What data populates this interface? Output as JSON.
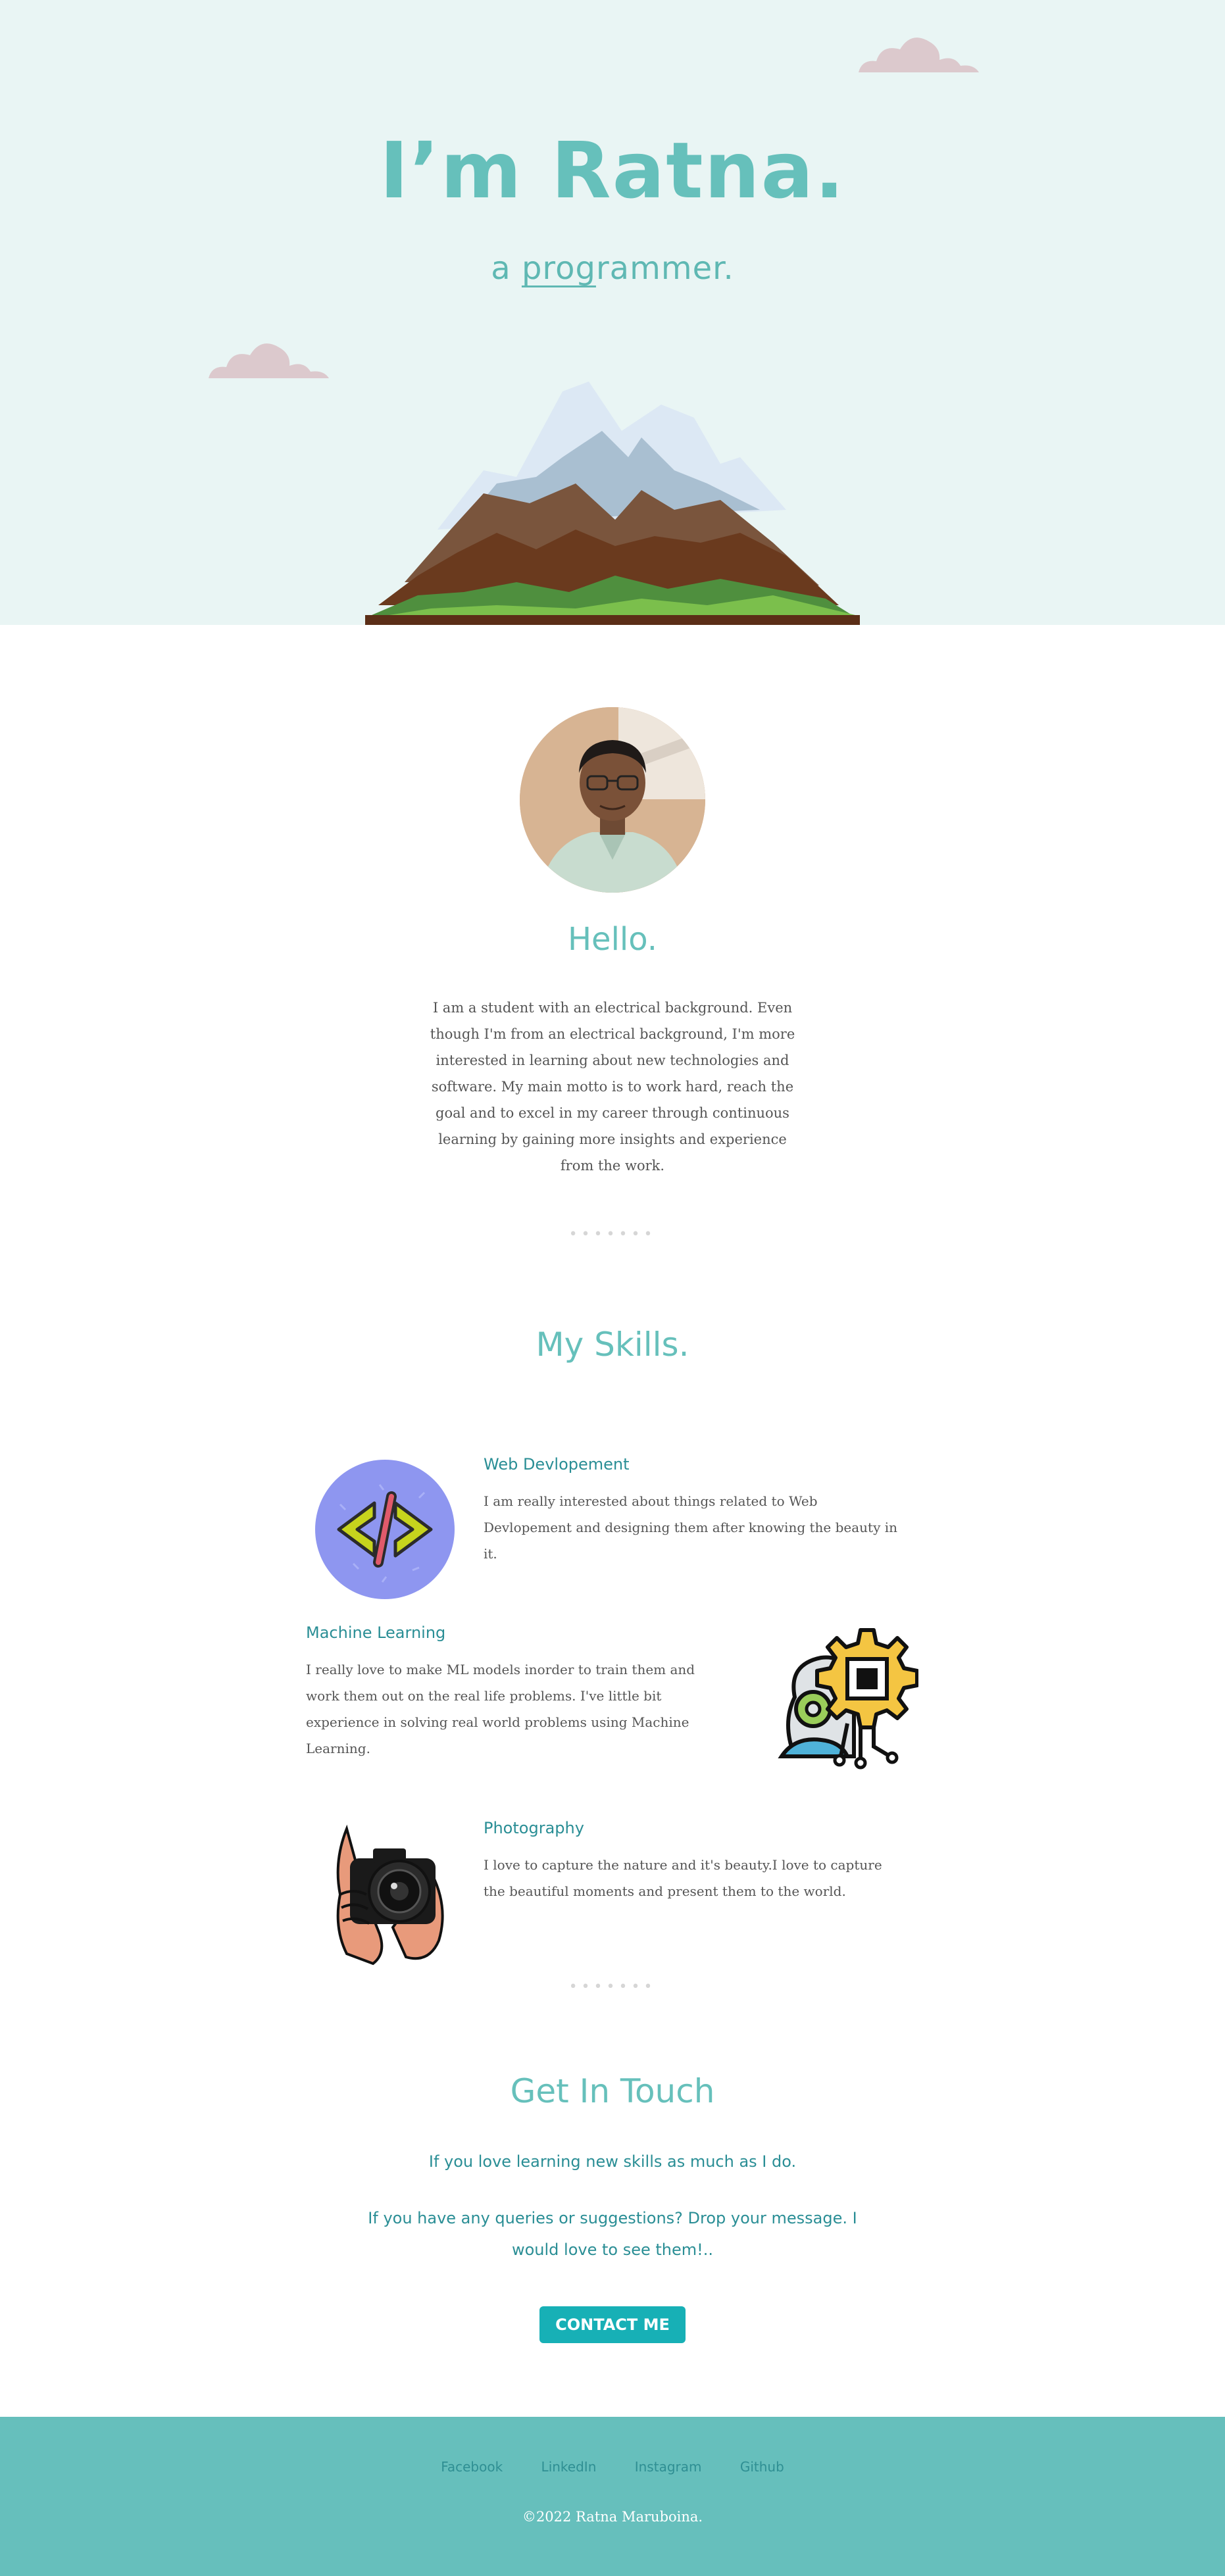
{
  "colors": {
    "accent": "#66c0bb",
    "hero_background": "#e9f5f4",
    "skill_heading": "#2a8e95",
    "button": "#17b0b6",
    "footer_background": "#66bfbc"
  },
  "hero": {
    "title": "I’m Ratna.",
    "subtitle_prefix": "a ",
    "subtitle_underlined": "prog",
    "subtitle_rest": "rammer.",
    "decorations": [
      "cloud-icon",
      "cloud-icon",
      "mountain-icon"
    ]
  },
  "about": {
    "photo": "profile-photo",
    "heading": "Hello.",
    "body": "I am a student with an electrical background. Even though I'm from an electrical background, I'm more interested in learning about new technologies and software. My main motto is to work hard, reach the goal and to excel in my career through continuous learning by gaining more insights and experience from the work."
  },
  "separator": "•••••••",
  "skills": {
    "heading": "My Skills.",
    "items": [
      {
        "title": "Web Devlopement",
        "icon": "code-icon",
        "text": "I am really interested about things related to Web Devlopement and designing them after knowing the beauty in it."
      },
      {
        "title": "Machine Learning",
        "icon": "robot-chip-icon",
        "text": "I really love to make ML models inorder to train them and work them out on the real life problems. I've little bit experience in solving real world problems using Machine Learning."
      },
      {
        "title": "Photography",
        "icon": "camera-icon",
        "text": "I love to capture the nature and it's beauty.I love to capture the beautiful moments and present them to the world."
      }
    ]
  },
  "contact": {
    "heading": "Get In Touch",
    "line1": "If you love learning new skills as much as I do.",
    "line2": "If you have any queries or suggestions? Drop your message. I would love to see them!..",
    "button_label": "CONTACT ME"
  },
  "footer": {
    "links": [
      "Facebook",
      "LinkedIn",
      "Instagram",
      "Github"
    ],
    "copyright": "©2022 Ratna Maruboina."
  }
}
